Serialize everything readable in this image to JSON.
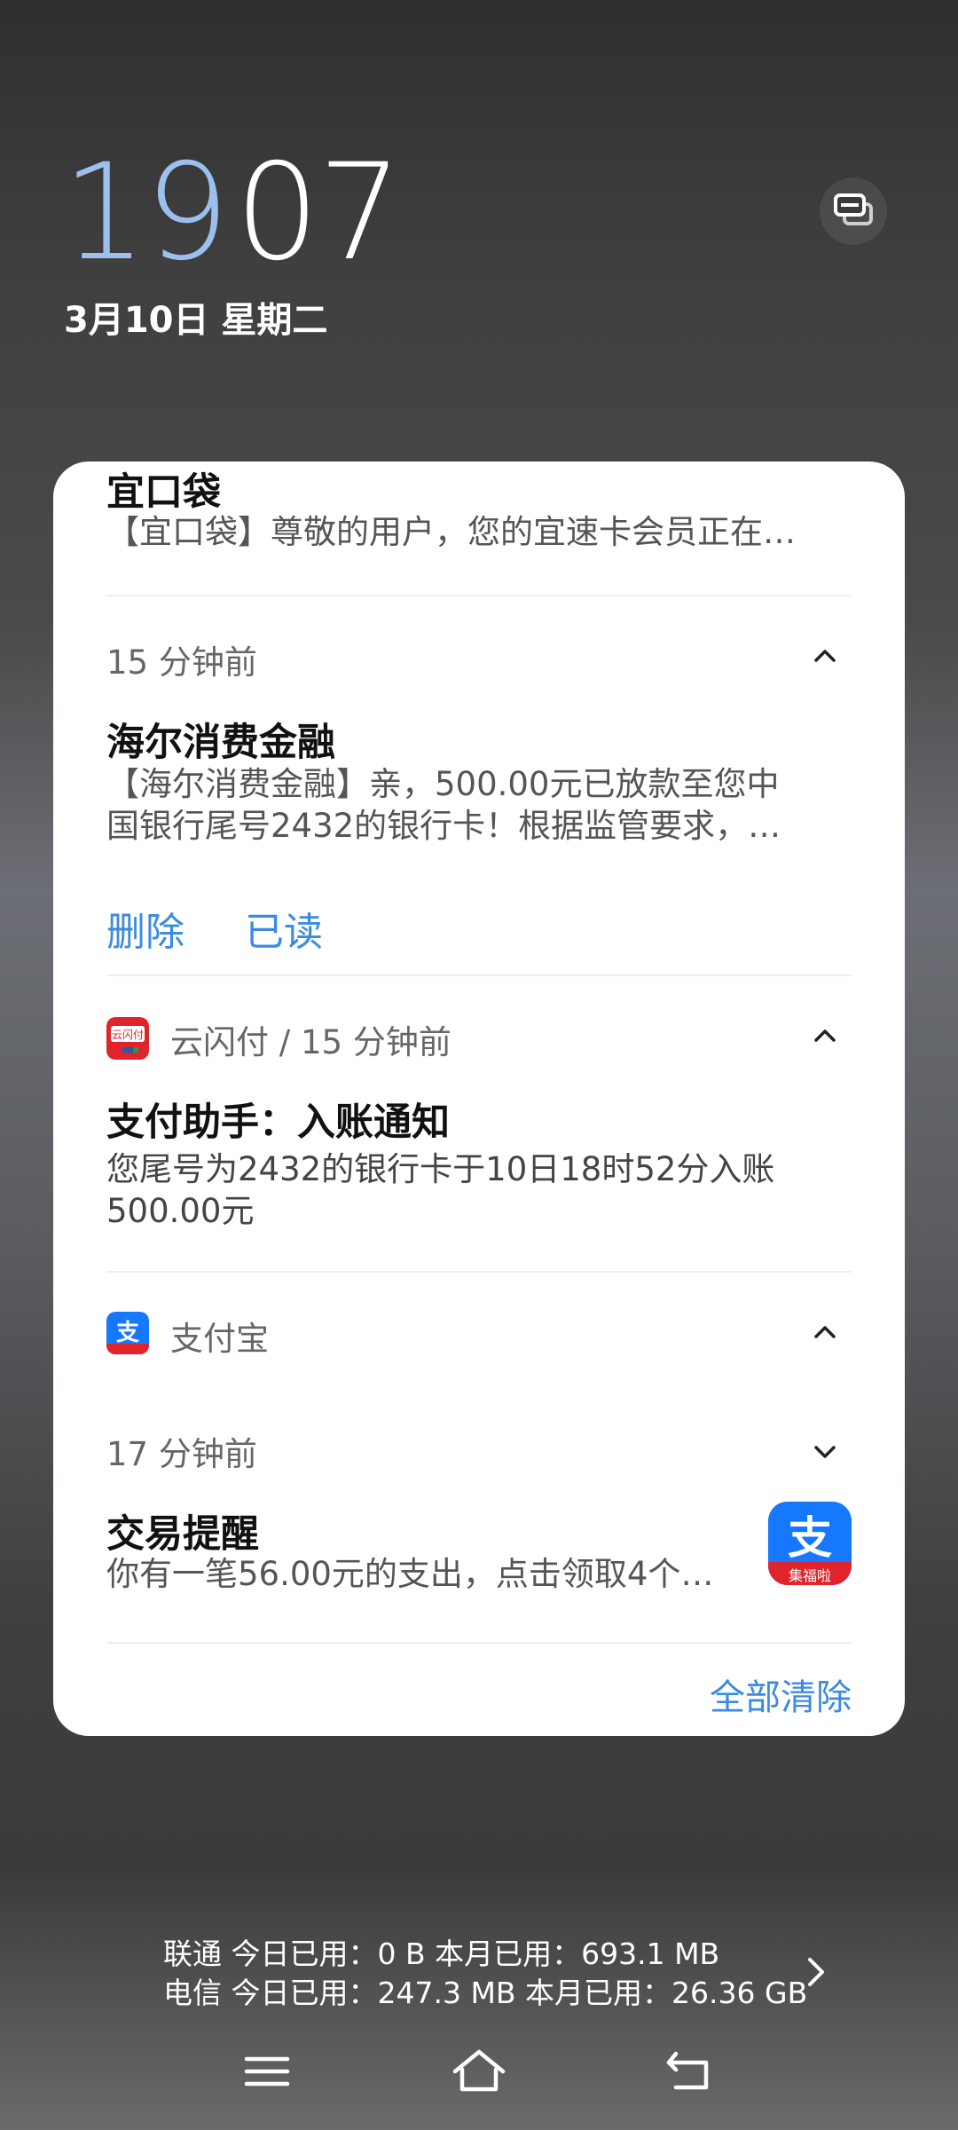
{
  "lockscreen": {
    "time_hour": "19",
    "time_minute": "07",
    "date": "3月10日 星期二"
  },
  "notifications": [
    {
      "app": "",
      "title": "宜口袋",
      "body": "【宜口袋】尊敬的用户，您的宜速卡会员正在…"
    },
    {
      "time": "15 分钟前",
      "title": "海尔消费金融",
      "body_line1": "【海尔消费金融】亲，500.00元已放款至您中",
      "body_line2": "国银行尾号2432的银行卡！根据监管要求，…",
      "actions": [
        "删除",
        "已读"
      ]
    },
    {
      "app_time": "云闪付 / 15 分钟前",
      "title": "支付助手：入账通知",
      "body_line1": "您尾号为2432的银行卡于10日18时52分入账",
      "body_line2": "500.00元"
    },
    {
      "app": "支付宝",
      "time": "17 分钟前",
      "title": "交易提醒",
      "body": "你有一笔56.00元的支出，点击领取4个…",
      "badge": "集福啦"
    }
  ],
  "clear_all": "全部清除",
  "data_usage": {
    "line1": "联通 今日已用：0 B 本月已用：693.1 MB",
    "line2": "电信 今日已用：247.3 MB 本月已用：26.36 GB"
  },
  "icons": {
    "unionpay": "yunshanfu-icon",
    "alipay": "alipay-icon",
    "menu": "menu-icon",
    "home": "home-icon",
    "back": "back-icon"
  },
  "colors": {
    "accent": "#3b8bdf",
    "clock_hour": "#9cc0ee",
    "alipay_blue": "#1677ff",
    "unionpay_red": "#e0242b"
  }
}
